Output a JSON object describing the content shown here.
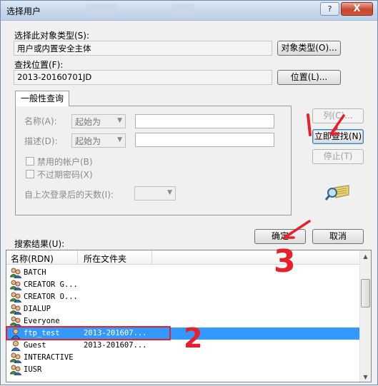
{
  "window": {
    "title": "选择用户",
    "help_label": "?",
    "close_label": "X"
  },
  "object_type": {
    "label": "选择此对象类型(S):",
    "value": "用户或内置安全主体",
    "button": "对象类型(O)..."
  },
  "location": {
    "label": "查找位置(F):",
    "value": "2013-20160701JD",
    "button": "位置(L)..."
  },
  "tab_label": "一般性查询",
  "query": {
    "name_label": "名称(A):",
    "name_mode": "起始为",
    "desc_label": "描述(D):",
    "desc_mode": "起始为",
    "disabled_accounts": "禁用的帐户(B)",
    "non_expiring_pw": "不过期密码(X)",
    "days_label": "自上次登录后的天数(I):"
  },
  "buttons": {
    "columns": "列(C)...",
    "find_now": "立即查找(N)",
    "stop": "停止(T)",
    "ok": "确定",
    "cancel": "取消"
  },
  "results": {
    "label": "搜索结果(U):",
    "columns": [
      "名称(RDN)",
      "所在文件夹"
    ],
    "rows": [
      {
        "name": "BATCH",
        "folder": "",
        "icon": "group-icon"
      },
      {
        "name": "CREATOR G...",
        "folder": "",
        "icon": "group-icon"
      },
      {
        "name": "CREATOR O...",
        "folder": "",
        "icon": "group-icon"
      },
      {
        "name": "DIALUP",
        "folder": "",
        "icon": "group-icon"
      },
      {
        "name": "Everyone",
        "folder": "",
        "icon": "group-icon"
      },
      {
        "name": "ftp_test",
        "folder": "2013-201607...",
        "icon": "user-icon",
        "selected": true
      },
      {
        "name": "Guest",
        "folder": "2013-201607...",
        "icon": "user-icon"
      },
      {
        "name": "INTERACTIVE",
        "folder": "",
        "icon": "group-icon"
      },
      {
        "name": "IUSR",
        "folder": "",
        "icon": "group-icon"
      }
    ]
  },
  "annotations": {
    "step1": "1",
    "step2": "2",
    "step3": "3",
    "color": "#e8202a"
  }
}
